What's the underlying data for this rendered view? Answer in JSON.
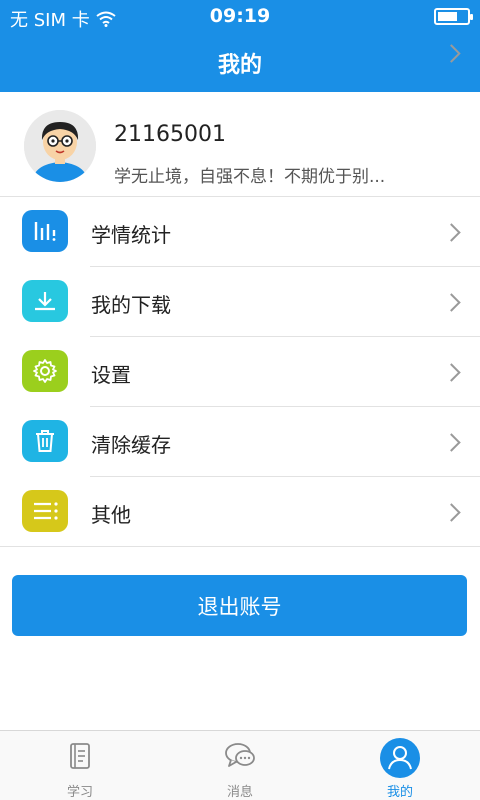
{
  "status_bar": {
    "carrier": "无 SIM 卡",
    "time": "09:19",
    "icons": [
      "wifi-icon",
      "battery-icon"
    ]
  },
  "header": {
    "title": "我的"
  },
  "profile": {
    "user_id": "21165001",
    "motto": "学无止境，自强不息！不期优于别..."
  },
  "menu": {
    "items": [
      {
        "label": "学情统计",
        "icon": "stats-icon",
        "color": "#1a8fe6"
      },
      {
        "label": "我的下载",
        "icon": "download-icon",
        "color": "#28c8e0"
      },
      {
        "label": "设置",
        "icon": "gear-icon",
        "color": "#9bcf1d"
      },
      {
        "label": "清除缓存",
        "icon": "trash-icon",
        "color": "#1fb4e4"
      },
      {
        "label": "其他",
        "icon": "menu-list-icon",
        "color": "#d6c81a"
      }
    ]
  },
  "logout_button": {
    "label": "退出账号"
  },
  "tab_bar": {
    "tabs": [
      {
        "label": "学习",
        "icon": "book-icon",
        "active": false
      },
      {
        "label": "消息",
        "icon": "chat-icon",
        "active": false
      },
      {
        "label": "我的",
        "icon": "user-icon",
        "active": true
      }
    ]
  },
  "colors": {
    "accent": "#1a8fe6",
    "background": "#ffffff",
    "divider": "#e2e2e2"
  }
}
